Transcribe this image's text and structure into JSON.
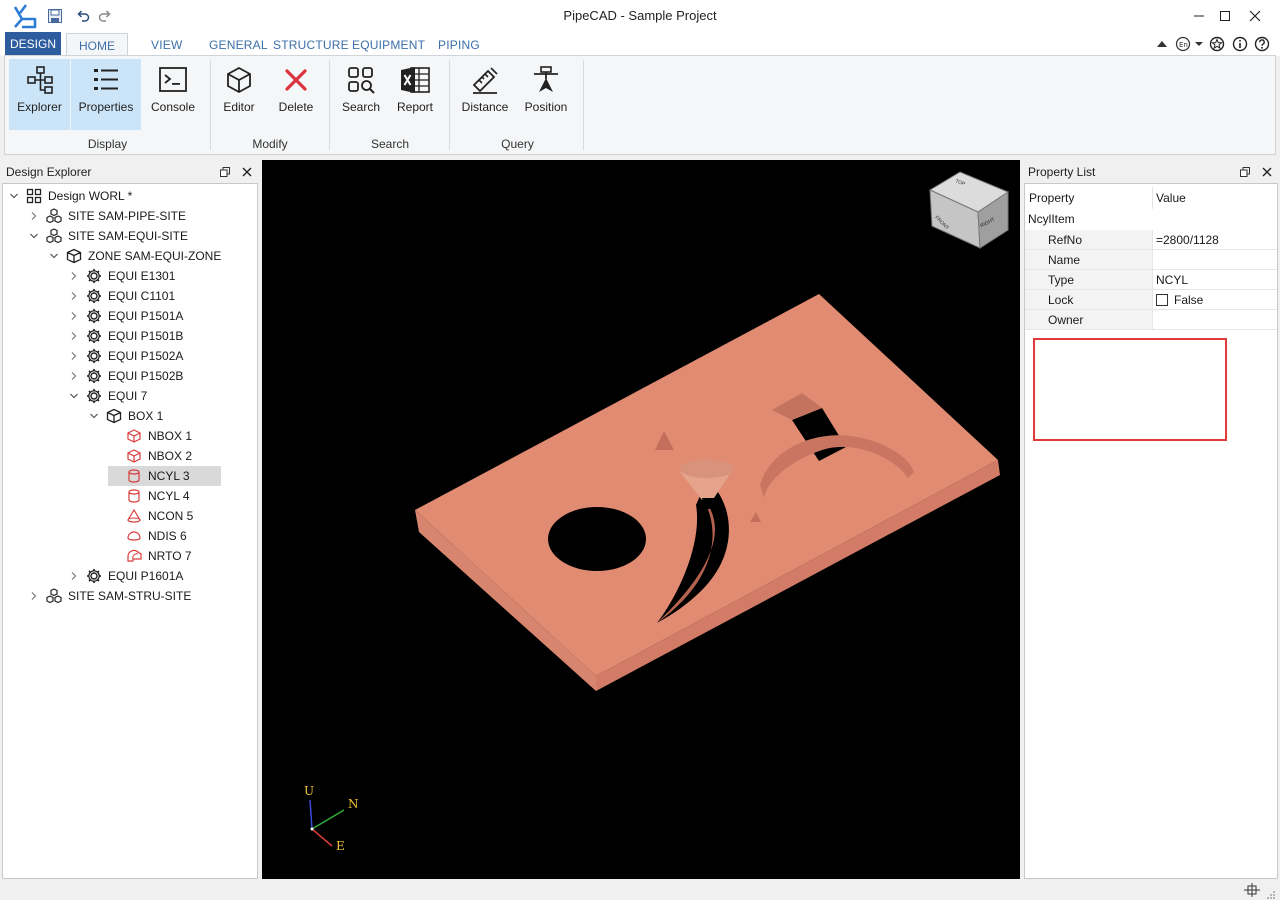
{
  "window": {
    "title": "PipeCAD - Sample Project"
  },
  "ribbon_tabs": {
    "design": "DESIGN",
    "home": "HOME",
    "view": "VIEW",
    "general": "GENERAL",
    "structure": "STRUCTURE",
    "equipment": "EQUIPMENT",
    "piping": "PIPING"
  },
  "ribbon": {
    "explorer": "Explorer",
    "properties": "Properties",
    "console": "Console",
    "editor": "Editor",
    "delete": "Delete",
    "search": "Search",
    "report": "Report",
    "distance": "Distance",
    "position": "Position",
    "group_display": "Display",
    "group_modify": "Modify",
    "group_search": "Search",
    "group_query": "Query"
  },
  "explorer": {
    "title": "Design Explorer",
    "items": [
      {
        "label": "Design WORL *",
        "icon": "world-icon"
      },
      {
        "label": "SITE SAM-PIPE-SITE",
        "icon": "site-icon"
      },
      {
        "label": "SITE SAM-EQUI-SITE",
        "icon": "site-icon"
      },
      {
        "label": "ZONE SAM-EQUI-ZONE",
        "icon": "zone-icon"
      },
      {
        "label": "EQUI E1301",
        "icon": "equipment-icon"
      },
      {
        "label": "EQUI C1101",
        "icon": "equipment-icon"
      },
      {
        "label": "EQUI P1501A",
        "icon": "equipment-icon"
      },
      {
        "label": "EQUI P1501B",
        "icon": "equipment-icon"
      },
      {
        "label": "EQUI P1502A",
        "icon": "equipment-icon"
      },
      {
        "label": "EQUI P1502B",
        "icon": "equipment-icon"
      },
      {
        "label": "EQUI 7",
        "icon": "equipment-icon"
      },
      {
        "label": "BOX 1",
        "icon": "box-icon"
      },
      {
        "label": "NBOX 1",
        "icon": "negative-box-icon"
      },
      {
        "label": "NBOX 2",
        "icon": "negative-box-icon"
      },
      {
        "label": "NCYL 3",
        "icon": "negative-cylinder-icon"
      },
      {
        "label": "NCYL 4",
        "icon": "negative-cylinder-icon"
      },
      {
        "label": "NCON 5",
        "icon": "negative-cone-icon"
      },
      {
        "label": "NDIS 6",
        "icon": "negative-dish-icon"
      },
      {
        "label": "NRTO 7",
        "icon": "negative-torus-icon"
      },
      {
        "label": "EQUI P1601A",
        "icon": "equipment-icon"
      },
      {
        "label": "SITE SAM-STRU-SITE",
        "icon": "site-icon"
      }
    ],
    "selected": "NCYL 3"
  },
  "viewport": {
    "axis_u": "U",
    "axis_n": "N",
    "axis_e": "E",
    "view_cube_faces": [
      "TOP",
      "FRONT",
      "RIGHT"
    ],
    "model_color": "#e08b72",
    "background": "#000000"
  },
  "property_list": {
    "title": "Property List",
    "col_property": "Property",
    "col_value": "Value",
    "item_type": "NcylItem",
    "rows": [
      {
        "key": "RefNo",
        "value": "=2800/1128"
      },
      {
        "key": "Name",
        "value": ""
      },
      {
        "key": "Type",
        "value": "NCYL"
      },
      {
        "key": "Lock",
        "value": "False"
      },
      {
        "key": "Owner",
        "value": ""
      }
    ]
  },
  "colors": {
    "accent": "#2d5d9f",
    "tab_text": "#3c6fa8",
    "active_button": "#cce4f7",
    "highlight_box": "#e03a3a",
    "delete_red": "#d9333f"
  }
}
